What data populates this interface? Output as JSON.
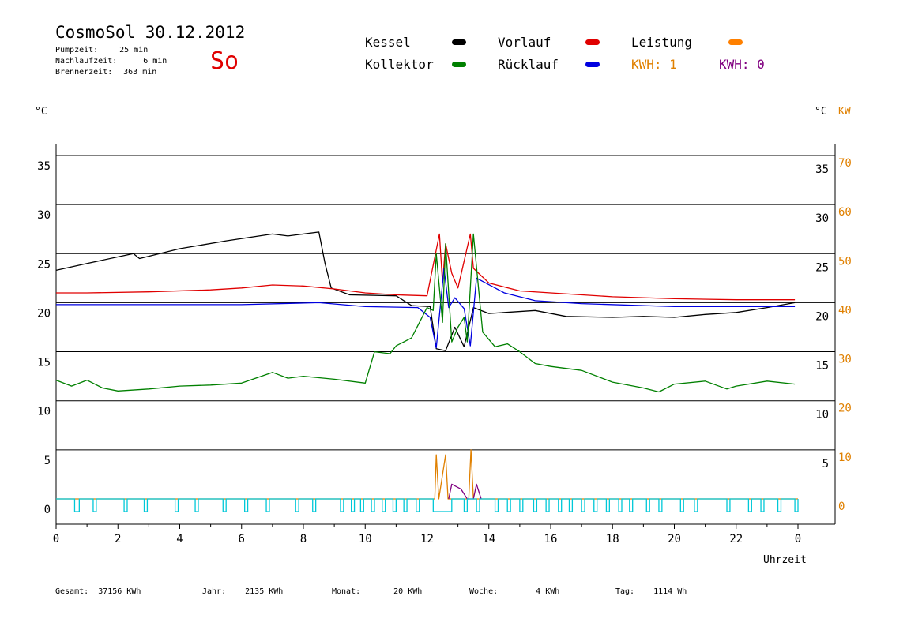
{
  "header": {
    "title": "CosmoSol 30.12.2012",
    "day": "So",
    "stats": [
      {
        "label": "Pumpzeit:",
        "value": "25 min"
      },
      {
        "label": "Nachlaufzeit:",
        "value": "6 min"
      },
      {
        "label": "Brennerzeit:",
        "value": "363 min"
      }
    ]
  },
  "legend": {
    "items": [
      {
        "label": "Kessel",
        "color": "#000000"
      },
      {
        "label": "Vorlauf",
        "color": "#e00000"
      },
      {
        "label": "Leistung",
        "color": "#ff8000"
      },
      {
        "label": "Kollektor",
        "color": "#008000"
      },
      {
        "label": "Rücklauf",
        "color": "#0000e0"
      }
    ],
    "kwh": [
      {
        "label": "KWH: 1",
        "color": "#e08000"
      },
      {
        "label": "KWH: 0",
        "color": "#800080"
      }
    ]
  },
  "axes": {
    "left_unit": "°C",
    "right_unit": "°C",
    "right_unit2": "KW",
    "x_label": "Uhrzeit"
  },
  "totals": [
    {
      "label": "Gesamt:",
      "value": "37156 KWh"
    },
    {
      "label": "Jahr:",
      "value": "2135 KWh"
    },
    {
      "label": "Monat:",
      "value": "20 KWh"
    },
    {
      "label": "Woche:",
      "value": "4 KWh"
    },
    {
      "label": "Tag:",
      "value": "1114 Wh"
    }
  ],
  "chart_data": {
    "type": "line",
    "xlabel": "Uhrzeit",
    "ylabel": "°C",
    "y2label": "KW",
    "xlim": [
      0,
      24
    ],
    "ylim": [
      0,
      35
    ],
    "y2lim": [
      0,
      70
    ],
    "grid": true,
    "x_ticks": [
      "0",
      "2",
      "4",
      "6",
      "8",
      "10",
      "12",
      "14",
      "16",
      "18",
      "20",
      "22",
      "0"
    ],
    "y_ticks_left": [
      "35",
      "30",
      "25",
      "20",
      "15",
      "10",
      "5",
      "0"
    ],
    "y_ticks_right": [
      "35",
      "30",
      "25",
      "20",
      "15",
      "10",
      "5"
    ],
    "y2_ticks": [
      "70",
      "60",
      "50",
      "40",
      "30",
      "20",
      "10",
      "0"
    ],
    "series": [
      {
        "name": "Kessel",
        "color": "#000000",
        "points": [
          [
            0,
            23.3
          ],
          [
            1,
            24
          ],
          [
            2.5,
            25
          ],
          [
            2.7,
            24.5
          ],
          [
            4,
            25.5
          ],
          [
            5.5,
            26.3
          ],
          [
            7,
            27
          ],
          [
            7.5,
            26.8
          ],
          [
            8.5,
            27.2
          ],
          [
            8.7,
            24
          ],
          [
            8.9,
            21.5
          ],
          [
            9.5,
            20.8
          ],
          [
            11,
            20.7
          ],
          [
            11.5,
            19.7
          ],
          [
            12.1,
            19.6
          ],
          [
            12.3,
            15.3
          ],
          [
            12.6,
            15.1
          ],
          [
            12.9,
            17.5
          ],
          [
            13.2,
            15.5
          ],
          [
            13.5,
            19.5
          ],
          [
            14,
            18.9
          ],
          [
            15.5,
            19.2
          ],
          [
            16.5,
            18.6
          ],
          [
            18,
            18.5
          ],
          [
            19,
            18.6
          ],
          [
            20,
            18.5
          ],
          [
            21,
            18.8
          ],
          [
            22,
            19
          ],
          [
            23,
            19.5
          ],
          [
            23.9,
            20
          ]
        ]
      },
      {
        "name": "Vorlauf",
        "color": "#e00000",
        "points": [
          [
            0,
            21
          ],
          [
            1,
            21
          ],
          [
            3,
            21.1
          ],
          [
            5,
            21.3
          ],
          [
            6,
            21.5
          ],
          [
            7,
            21.8
          ],
          [
            8,
            21.7
          ],
          [
            9,
            21.4
          ],
          [
            10,
            21
          ],
          [
            11,
            20.8
          ],
          [
            12,
            20.7
          ],
          [
            12.4,
            27
          ],
          [
            12.5,
            22
          ],
          [
            12.6,
            26
          ],
          [
            12.8,
            23
          ],
          [
            13,
            21.5
          ],
          [
            13.4,
            27
          ],
          [
            13.5,
            23.5
          ],
          [
            14,
            22
          ],
          [
            15,
            21.2
          ],
          [
            16,
            21
          ],
          [
            18,
            20.6
          ],
          [
            20,
            20.4
          ],
          [
            22,
            20.3
          ],
          [
            23.9,
            20.3
          ]
        ]
      },
      {
        "name": "Rücklauf",
        "color": "#0000e0",
        "points": [
          [
            0,
            19.8
          ],
          [
            3,
            19.8
          ],
          [
            6,
            19.8
          ],
          [
            8.5,
            20
          ],
          [
            10,
            19.6
          ],
          [
            11.7,
            19.5
          ],
          [
            12.1,
            18.5
          ],
          [
            12.3,
            15.4
          ],
          [
            12.55,
            23.5
          ],
          [
            12.7,
            19.5
          ],
          [
            12.9,
            20.5
          ],
          [
            13.2,
            19.4
          ],
          [
            13.4,
            15.6
          ],
          [
            13.6,
            22.5
          ],
          [
            14.5,
            21
          ],
          [
            15.5,
            20.2
          ],
          [
            17,
            19.9
          ],
          [
            20,
            19.6
          ],
          [
            22,
            19.6
          ],
          [
            23.9,
            19.6
          ]
        ]
      },
      {
        "name": "Kollektor",
        "color": "#008000",
        "points": [
          [
            0,
            12.1
          ],
          [
            0.5,
            11.5
          ],
          [
            1,
            12.1
          ],
          [
            1.5,
            11.3
          ],
          [
            2,
            11
          ],
          [
            3,
            11.2
          ],
          [
            4,
            11.5
          ],
          [
            5,
            11.6
          ],
          [
            6,
            11.8
          ],
          [
            7,
            12.9
          ],
          [
            7.5,
            12.3
          ],
          [
            8,
            12.5
          ],
          [
            9,
            12.2
          ],
          [
            10,
            11.8
          ],
          [
            10.3,
            15
          ],
          [
            10.8,
            14.8
          ],
          [
            11,
            15.6
          ],
          [
            11.5,
            16.4
          ],
          [
            12,
            19.5
          ],
          [
            12.2,
            19.2
          ],
          [
            12.3,
            25
          ],
          [
            12.5,
            18
          ],
          [
            12.6,
            26
          ],
          [
            12.8,
            16
          ],
          [
            13,
            17.5
          ],
          [
            13.2,
            18.5
          ],
          [
            13.3,
            16
          ],
          [
            13.5,
            27
          ],
          [
            13.8,
            17
          ],
          [
            14.2,
            15.5
          ],
          [
            14.6,
            15.8
          ],
          [
            15,
            15
          ],
          [
            15.5,
            13.8
          ],
          [
            16,
            13.5
          ],
          [
            17,
            13.1
          ],
          [
            18,
            11.9
          ],
          [
            19,
            11.3
          ],
          [
            19.5,
            10.9
          ],
          [
            20,
            11.7
          ],
          [
            21,
            12
          ],
          [
            21.7,
            11.2
          ],
          [
            22,
            11.5
          ],
          [
            23,
            12
          ],
          [
            23.9,
            11.7
          ]
        ]
      },
      {
        "name": "Leistung",
        "color": "#e08000",
        "axis": "y2",
        "points": [
          [
            0,
            0
          ],
          [
            12.25,
            0
          ],
          [
            12.3,
            9
          ],
          [
            12.38,
            0
          ],
          [
            12.6,
            9
          ],
          [
            12.68,
            0
          ],
          [
            13.35,
            0
          ],
          [
            13.42,
            10
          ],
          [
            13.5,
            0
          ],
          [
            24,
            0
          ]
        ]
      },
      {
        "name": "",
        "color": "#800080",
        "axis": "y2",
        "points": [
          [
            12.7,
            0
          ],
          [
            12.8,
            3
          ],
          [
            13.1,
            2
          ],
          [
            13.3,
            0
          ],
          [
            13.5,
            0
          ],
          [
            13.6,
            3
          ],
          [
            13.75,
            0
          ]
        ]
      },
      {
        "name": "",
        "color": "#00c8d8",
        "type": "pulses",
        "on": [
          [
            0.6,
            0.75
          ],
          [
            1.2,
            1.3
          ],
          [
            2.2,
            2.3
          ],
          [
            2.85,
            2.95
          ],
          [
            3.85,
            3.95
          ],
          [
            4.5,
            4.6
          ],
          [
            5.4,
            5.5
          ],
          [
            6.1,
            6.2
          ],
          [
            6.8,
            6.9
          ],
          [
            7.75,
            7.85
          ],
          [
            8.3,
            8.4
          ],
          [
            9.2,
            9.3
          ],
          [
            9.55,
            9.65
          ],
          [
            9.85,
            9.95
          ],
          [
            10.2,
            10.3
          ],
          [
            10.55,
            10.65
          ],
          [
            10.9,
            11
          ],
          [
            11.25,
            11.35
          ],
          [
            11.65,
            11.75
          ],
          [
            12.2,
            12.8
          ],
          [
            13.2,
            13.3
          ],
          [
            13.6,
            13.7
          ],
          [
            14.2,
            14.3
          ],
          [
            14.6,
            14.7
          ],
          [
            15,
            15.1
          ],
          [
            15.45,
            15.55
          ],
          [
            15.85,
            15.95
          ],
          [
            16.25,
            16.35
          ],
          [
            16.6,
            16.7
          ],
          [
            17,
            17.1
          ],
          [
            17.4,
            17.5
          ],
          [
            17.8,
            17.9
          ],
          [
            18.2,
            18.3
          ],
          [
            18.55,
            18.65
          ],
          [
            19.1,
            19.2
          ],
          [
            19.5,
            19.6
          ],
          [
            20.2,
            20.3
          ],
          [
            20.65,
            20.75
          ],
          [
            21.7,
            21.8
          ],
          [
            22.4,
            22.5
          ],
          [
            22.8,
            22.9
          ],
          [
            23.35,
            23.45
          ],
          [
            23.9,
            24
          ]
        ]
      }
    ]
  }
}
